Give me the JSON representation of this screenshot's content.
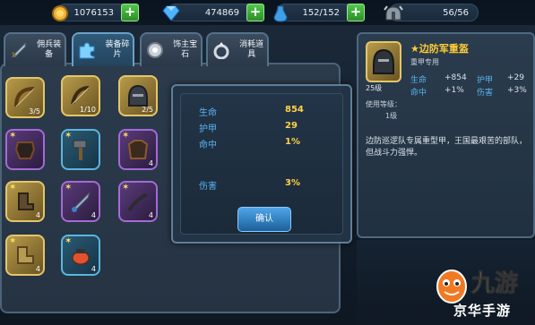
{
  "resources": [
    {
      "name": "gold",
      "icon": "gold-coin-icon",
      "value": "1076153"
    },
    {
      "name": "diamond",
      "icon": "blue-diamond-icon",
      "value": "474869"
    },
    {
      "name": "stamina",
      "icon": "stamina-potion-icon",
      "value": "152/152"
    },
    {
      "name": "troops",
      "icon": "helmet-icon",
      "value": "56/56"
    }
  ],
  "tabs": [
    {
      "label": "佣兵装备",
      "icon": "sword-icon"
    },
    {
      "label": "装备碎片",
      "icon": "puzzle-icon"
    },
    {
      "label": "饰主宝石",
      "icon": "gem-icon"
    },
    {
      "label": "消耗道具",
      "icon": "ring-icon"
    }
  ],
  "inventory": [
    {
      "type": "gold",
      "star": false,
      "count": "3/5"
    },
    {
      "type": "gold",
      "star": false,
      "count": "1/10"
    },
    {
      "type": "gold",
      "star": false,
      "count": "2/5"
    },
    {
      "type": "purple",
      "star": true,
      "count": ""
    },
    {
      "type": "blue",
      "star": true,
      "count": ""
    },
    {
      "type": "purple",
      "star": true,
      "count": "4"
    },
    {
      "type": "gold",
      "star": true,
      "count": "4"
    },
    {
      "type": "purple",
      "star": true,
      "count": "4"
    },
    {
      "type": "purple",
      "star": true,
      "count": "4"
    },
    {
      "type": "gold",
      "star": true,
      "count": "4"
    },
    {
      "type": "blue",
      "star": true,
      "count": "4"
    }
  ],
  "popup": {
    "stats": [
      {
        "label": "生命",
        "value": "854"
      },
      {
        "label": "护甲",
        "value": "29"
      },
      {
        "label": "命中",
        "value": "1%"
      },
      {
        "label": "伤害",
        "value": "3%"
      }
    ],
    "confirm_label": "确认"
  },
  "detail": {
    "name": "★边防军重盔",
    "subtitle": "重甲专用",
    "level_tag": "25级",
    "stats": [
      {
        "label": "生命",
        "value": "+854"
      },
      {
        "label": "护甲",
        "value": "+29"
      },
      {
        "label": "命中",
        "value": "+1%"
      },
      {
        "label": "伤害",
        "value": "+3%"
      }
    ],
    "use_level_label": "使用等级：",
    "use_level_value": "1级",
    "description": "边防巡逻队专属重型甲，王国最艰苦的部队，但战斗力强悍。"
  },
  "watermark": {
    "line1": "九游",
    "line2": "京华手游"
  }
}
